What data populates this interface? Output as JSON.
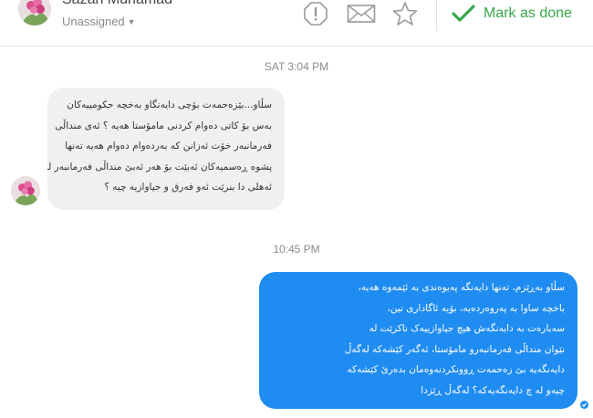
{
  "header": {
    "contact_name": "Sazan Muhamad",
    "assignee": "Unassigned",
    "mark_done_label": "Mark as done",
    "accent_color": "#37a84b"
  },
  "conversation": {
    "timestamps": [
      "SAT 3:04 PM",
      "10:45 PM"
    ],
    "incoming": {
      "lines": [
        "سڵاو...بێزەحمەت بۆچی دایەنگاو بەخچە حکومییەکان",
        "بەس بۆ کاتی دەوام کردنی مامۆستا هەیە ؟ ئەی منداڵی",
        "فەرمانبەر خۆت ئەزانن کە بەردەوام دەوام هەیە تەنها",
        "پشوە ڕەسمیەکان ئەبێت بۆ هەر ئەبێ منداڵی فەرمانبەر لە",
        "ئەهلی دا بنرێت ئەو فەرق و جیاوازیە چیە ؟"
      ]
    },
    "outgoing": {
      "lines": [
        "سڵاو بەڕێزم، تەنها دایەنگە پەیوەندی بە ئێمەوە هەیە،",
        "باخچە ساوا بە پەروەردەیە، بۆیە ئاگاداری نین،",
        "سەبارەت بە دایەنگەش هیچ جیاوازییەک ناکرێت لە",
        "نێوان منداڵی فەرمانبەرو مامۆستا، ئەگەر کێشەکە لەگەڵ",
        "دایەنگەیە بێ زەحمەت ڕوونکردنەوەمان بدەرێ کێشەکە",
        "چیەو لە چ دایەنگەیەکە؟ لەگەڵ ڕێزدا"
      ],
      "bubble_color": "#1f8cf1"
    }
  }
}
